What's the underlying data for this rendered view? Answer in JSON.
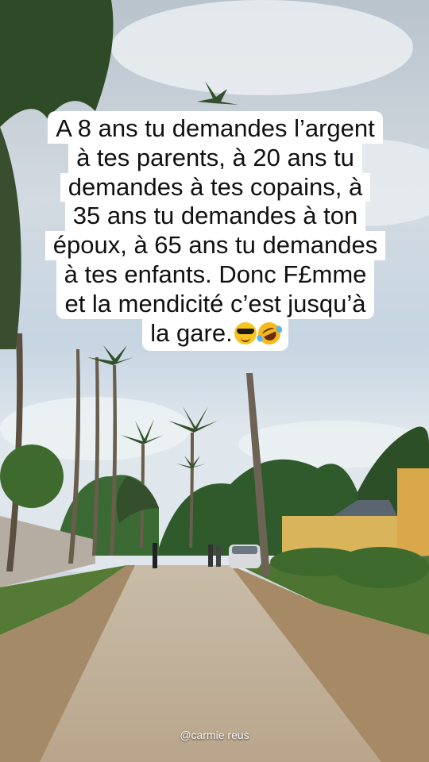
{
  "caption": {
    "lines": [
      "A 8 ans tu demandes l’argent",
      "à tes parents, à 20 ans tu",
      "demandes à tes copains, à",
      "35 ans tu demandes à ton",
      "époux, à 65 ans tu demandes",
      "à tes enfants. Donc F£mme",
      "et la mendicité c’est jusqu’à",
      "la gare."
    ],
    "emojis": [
      "smiling-face-with-sunglasses",
      "rolling-on-floor-laughing"
    ]
  },
  "watermark": "@carmie reus"
}
